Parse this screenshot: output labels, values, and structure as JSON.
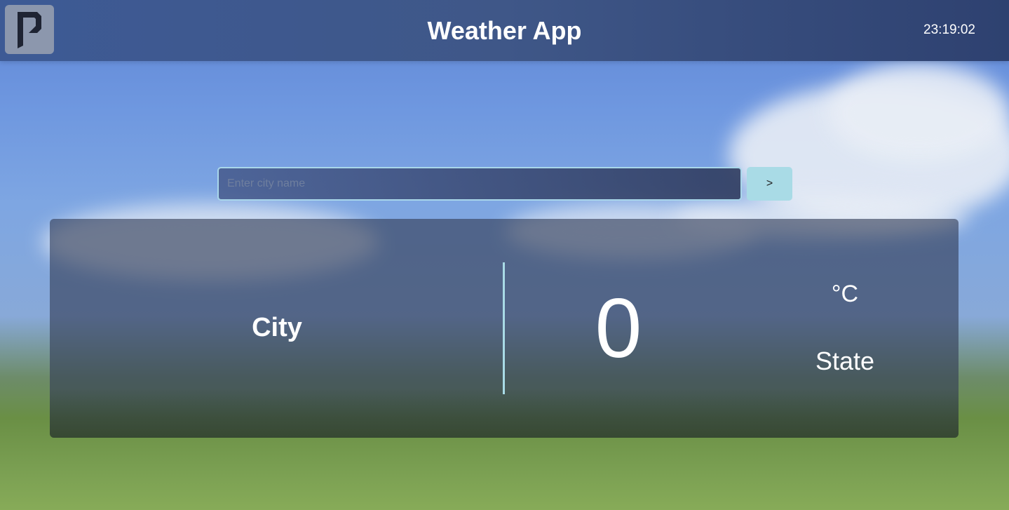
{
  "header": {
    "title": "Weather App",
    "time": "23:19:02",
    "logo_icon": "logo-icon"
  },
  "search": {
    "placeholder": "Enter city name",
    "value": "",
    "button_label": ">"
  },
  "weather": {
    "city": "City",
    "temperature": "0",
    "unit": "°C",
    "state": "State"
  },
  "colors": {
    "accent": "#a9dbe6",
    "header": "#3f5788",
    "text": "#ffffff"
  }
}
